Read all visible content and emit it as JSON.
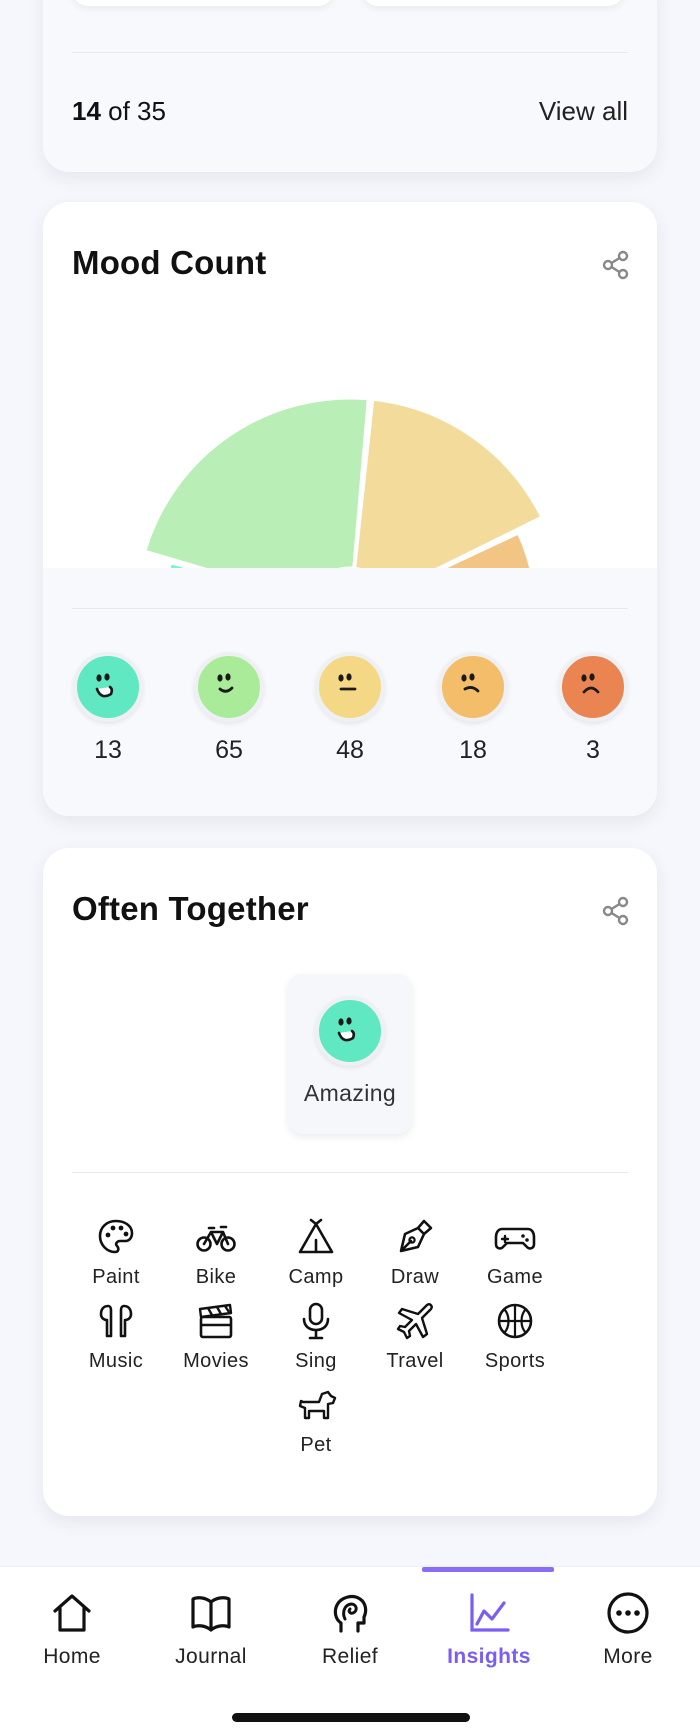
{
  "top_card": {
    "count_current": "14",
    "count_rest": " of 35",
    "view_all": "View all"
  },
  "mood_card": {
    "title": "Mood Count",
    "moods": [
      {
        "name": "amazing",
        "count": "13",
        "color": "#79f3c8"
      },
      {
        "name": "good",
        "count": "65",
        "color": "#b9efb6"
      },
      {
        "name": "meh",
        "count": "48",
        "color": "#f3dc9b"
      },
      {
        "name": "bad",
        "count": "18",
        "color": "#f2c585"
      },
      {
        "name": "awful",
        "count": "3",
        "color": "#ee9d6e"
      }
    ],
    "face_colors": [
      "#5fe8c2",
      "#a9eb98",
      "#f5d886",
      "#f4bd6a",
      "#ea8552"
    ]
  },
  "often_card": {
    "title": "Often Together",
    "selected_mood": "Amazing",
    "selected_color": "#5fe8c2",
    "activities": [
      {
        "label": "Paint",
        "icon": "palette-icon"
      },
      {
        "label": "Bike",
        "icon": "bike-icon"
      },
      {
        "label": "Camp",
        "icon": "tent-icon"
      },
      {
        "label": "Draw",
        "icon": "pen-icon"
      },
      {
        "label": "Game",
        "icon": "gamepad-icon"
      },
      {
        "label": "Music",
        "icon": "earbuds-icon"
      },
      {
        "label": "Movies",
        "icon": "clapperboard-icon"
      },
      {
        "label": "Sing",
        "icon": "microphone-icon"
      },
      {
        "label": "Travel",
        "icon": "airplane-icon"
      },
      {
        "label": "Sports",
        "icon": "ball-icon"
      },
      {
        "label": "Pet",
        "icon": "dog-icon"
      }
    ]
  },
  "tabbar": {
    "tabs": [
      {
        "label": "Home",
        "icon": "home-icon"
      },
      {
        "label": "Journal",
        "icon": "book-icon"
      },
      {
        "label": "Relief",
        "icon": "head-icon"
      },
      {
        "label": "Insights",
        "icon": "chart-icon"
      },
      {
        "label": "More",
        "icon": "more-icon"
      }
    ],
    "active": "Insights",
    "accent": "#7a5df2"
  }
}
